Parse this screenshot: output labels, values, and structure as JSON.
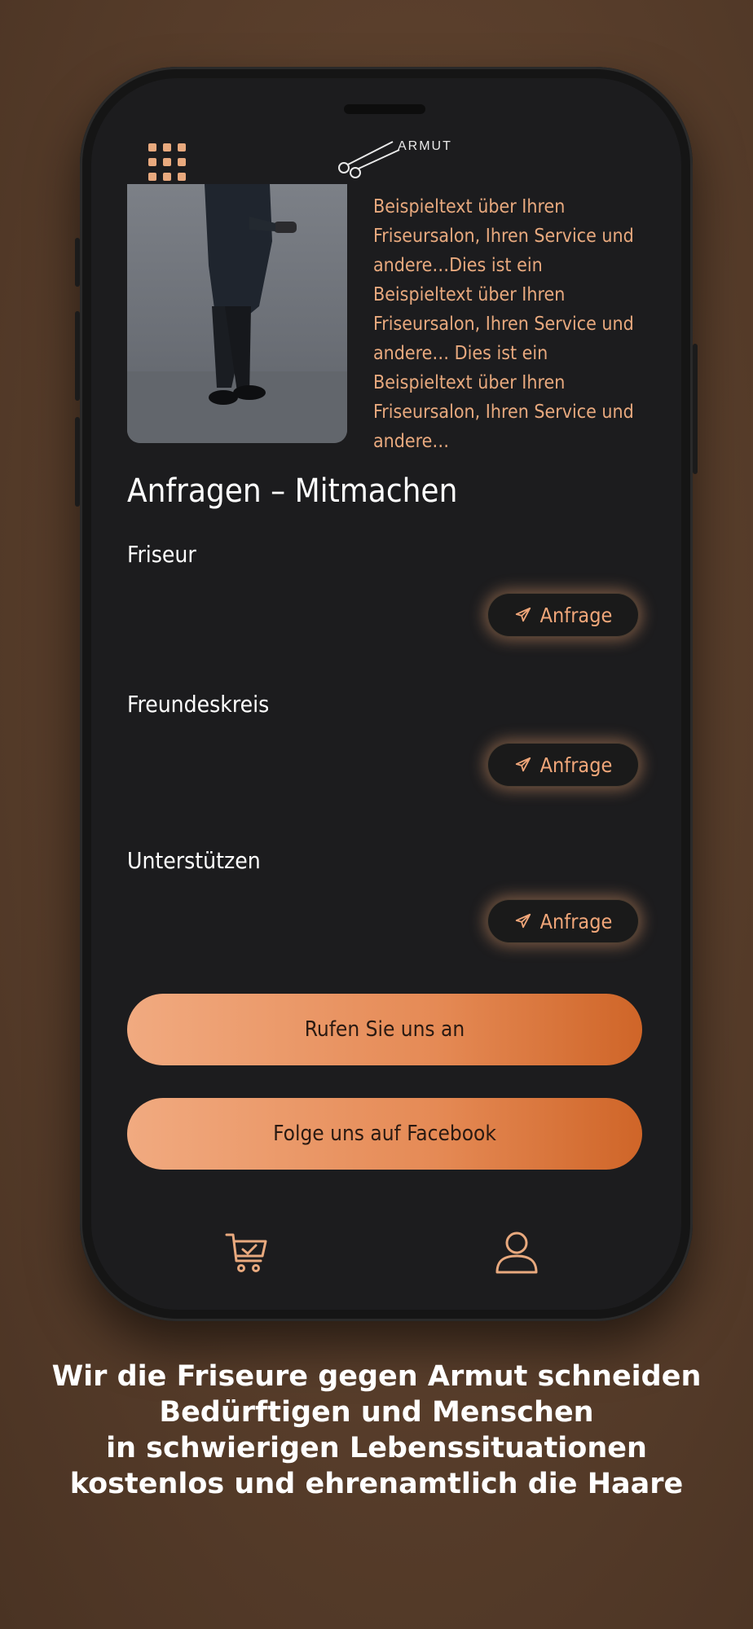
{
  "header": {
    "menu_icon": "grid-menu-icon",
    "logo_text": "ARMUT",
    "logo_icon": "scissors-icon"
  },
  "intro": {
    "text": "Beispieltext über Ihren Friseursalon, Ihren Service und andere…Dies ist ein Beispieltext über Ihren Friseursalon, Ihren Service und andere… Dies ist ein Beispieltext über Ihren Friseursalon, Ihren Service und andere…"
  },
  "section": {
    "title": "Anfragen – Mitmachen",
    "items": [
      {
        "label": "Friseur",
        "button": "Anfrage"
      },
      {
        "label": "Freundeskreis",
        "button": "Anfrage"
      },
      {
        "label": "Unterstützen",
        "button": "Anfrage"
      }
    ]
  },
  "actions": {
    "call": "Rufen Sie uns an",
    "facebook": "Folge uns auf Facebook"
  },
  "tabbar": {
    "items": [
      "cart-icon",
      "user-icon"
    ]
  },
  "caption": {
    "lines": [
      "Wir die Friseure gegen Armut schneiden",
      "Bedürftigen und Menschen",
      "in schwierigen Lebenssituationen",
      "kostenlos und ehrenamtlich die Haare"
    ]
  },
  "colors": {
    "accent": "#e8a97e",
    "cta_start": "#f1aa80",
    "cta_end": "#cf6528",
    "screen_bg": "#1c1c1e"
  }
}
